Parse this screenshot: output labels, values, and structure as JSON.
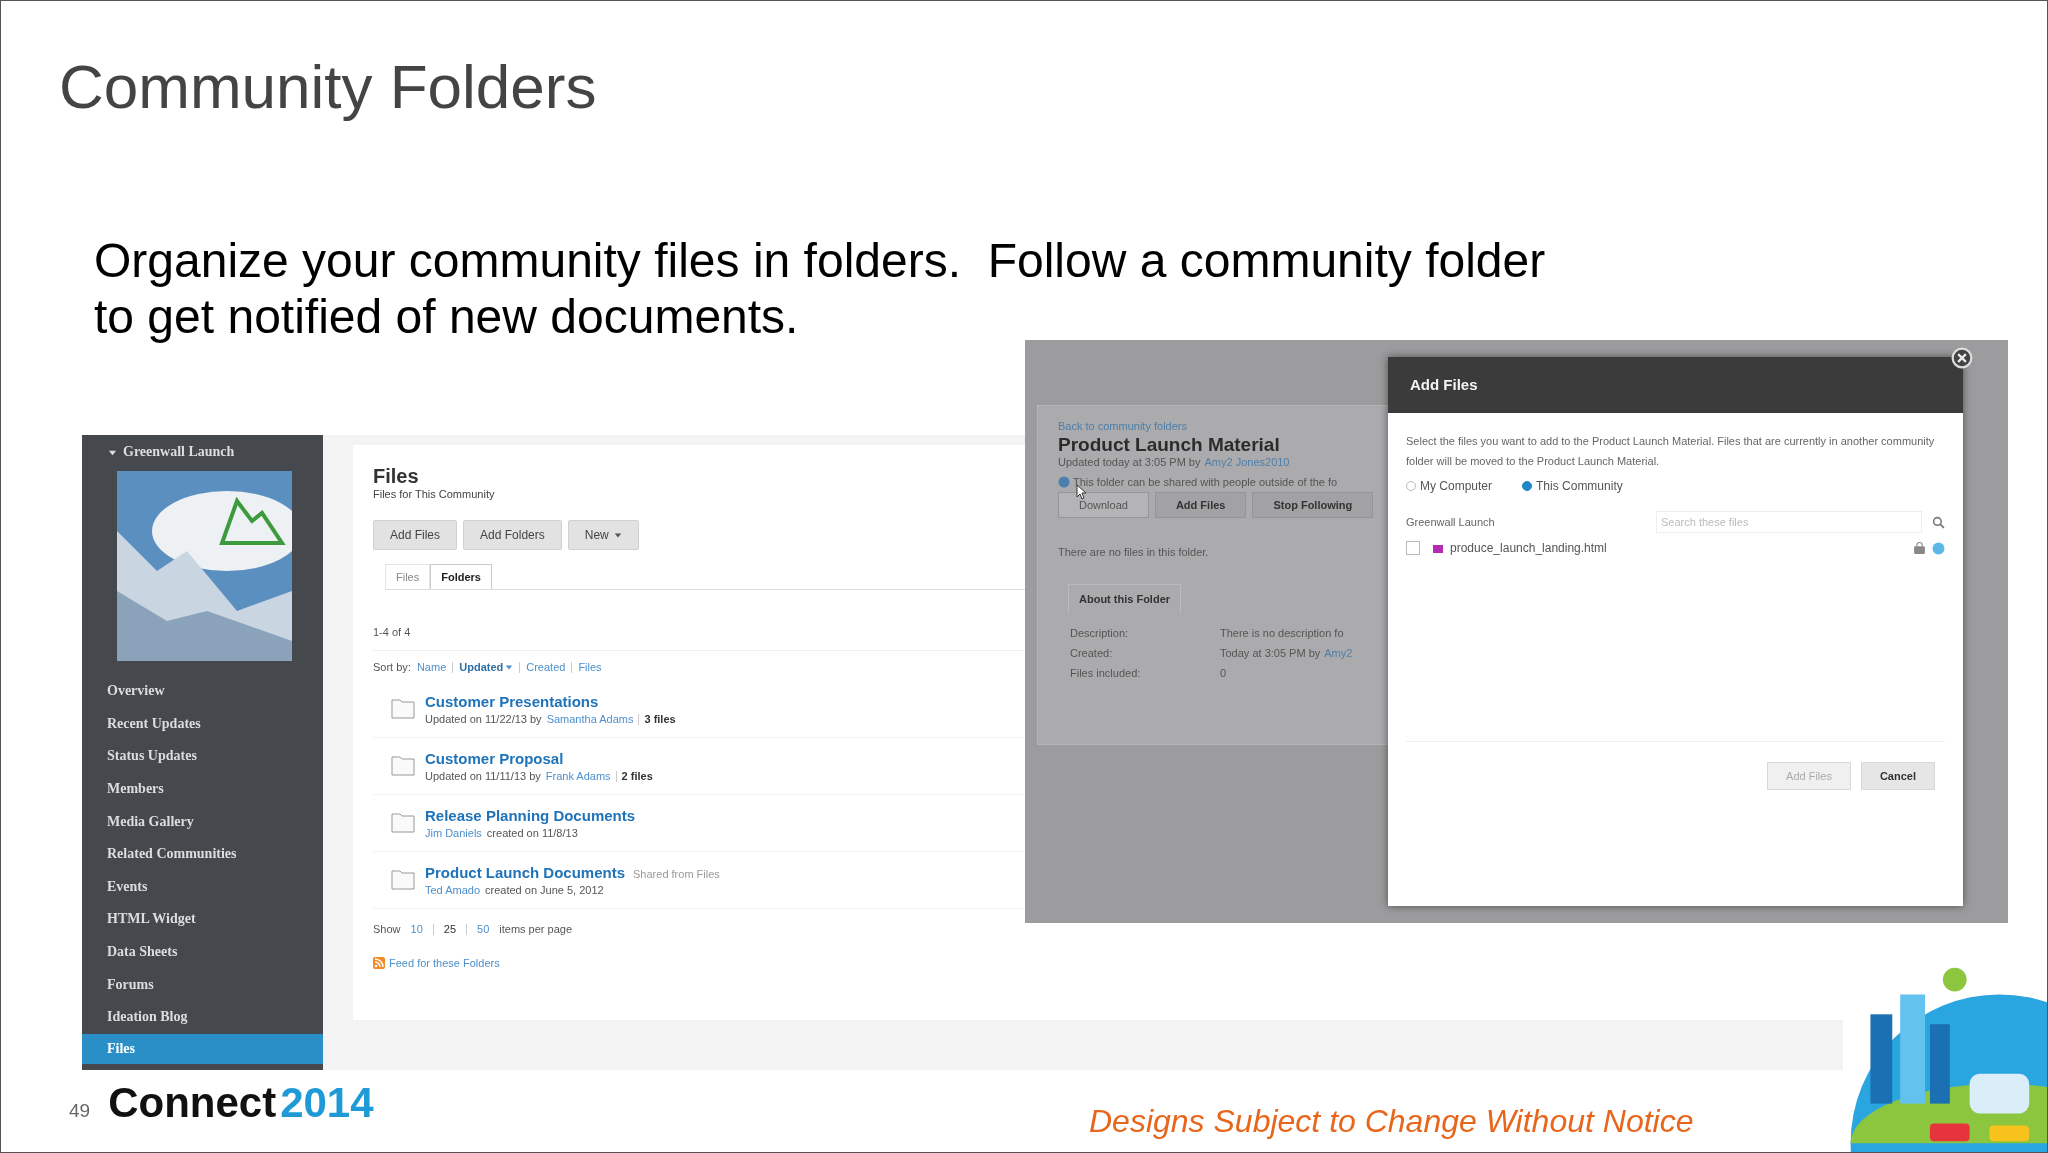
{
  "slide": {
    "title": "Community Folders",
    "subtitle_lines": [
      "Organize your community files in folders.  Follow a community folder",
      "to get notified of new documents."
    ],
    "page_number": "49",
    "brand": {
      "word": "Connect",
      "year": "2014"
    },
    "disclaimer": "Designs Subject to Change Without Notice"
  },
  "community_page": {
    "sidebar": {
      "community": "Greenwall Launch",
      "expanded": true,
      "items": [
        {
          "label": "Overview",
          "selected": false
        },
        {
          "label": "Recent Updates",
          "selected": false
        },
        {
          "label": "Status Updates",
          "selected": false
        },
        {
          "label": "Members",
          "selected": false
        },
        {
          "label": "Media Gallery",
          "selected": false
        },
        {
          "label": "Related Communities",
          "selected": false
        },
        {
          "label": "Events",
          "selected": false
        },
        {
          "label": "HTML Widget",
          "selected": false
        },
        {
          "label": "Data Sheets",
          "selected": false
        },
        {
          "label": "Forums",
          "selected": false
        },
        {
          "label": "Ideation Blog",
          "selected": false
        },
        {
          "label": "Files",
          "selected": true
        }
      ]
    },
    "files": {
      "title": "Files",
      "subtitle": "Files for This Community",
      "buttons": [
        {
          "label": "Add Files",
          "kind": "plain"
        },
        {
          "label": "Add Folders",
          "kind": "plain"
        },
        {
          "label": "New",
          "kind": "menu"
        }
      ],
      "tabs": [
        {
          "label": "Files",
          "selected": false
        },
        {
          "label": "Folders",
          "selected": true
        }
      ],
      "count": "1-4 of 4",
      "sort_label": "Sort by:",
      "sort_options": [
        {
          "label": "Name",
          "selected": false
        },
        {
          "label": "Updated",
          "selected": true
        },
        {
          "label": "Created",
          "selected": false
        },
        {
          "label": "Files",
          "selected": false
        }
      ],
      "folders": [
        {
          "title": "Customer Presentations",
          "meta": [
            {
              "kind": "text",
              "text": "Updated on 11/22/13 by"
            },
            {
              "kind": "link",
              "text": "Samantha Adams"
            },
            {
              "kind": "divider"
            },
            {
              "kind": "bold",
              "text": "3 files"
            }
          ]
        },
        {
          "title": "Customer Proposal",
          "meta": [
            {
              "kind": "text",
              "text": "Updated on 11/11/13 by"
            },
            {
              "kind": "link",
              "text": "Frank Adams"
            },
            {
              "kind": "divider"
            },
            {
              "kind": "bold",
              "text": "2 files"
            }
          ]
        },
        {
          "title": "Release Planning Documents",
          "meta": [
            {
              "kind": "link",
              "text": "Jim Daniels"
            },
            {
              "kind": "text",
              "text": "created on 11/8/13"
            }
          ]
        },
        {
          "title": "Product Launch Documents",
          "note": "Shared from Files",
          "meta": [
            {
              "kind": "link",
              "text": "Ted Amado"
            },
            {
              "kind": "text",
              "text": "created on June 5, 2012"
            }
          ]
        }
      ],
      "show_label": "Show",
      "page_sizes": [
        {
          "label": "10",
          "selected": false
        },
        {
          "label": "25",
          "selected": true
        },
        {
          "label": "50",
          "selected": false
        }
      ],
      "per_page_label": "items per page",
      "feed_link": "Feed for these Folders"
    }
  },
  "add_files_screen": {
    "folder_page": {
      "back_link": "Back to community folders",
      "title": "Product Launch Material",
      "updated": "Updated today at 3:05 PM by",
      "updated_by": "Amy2 Jones2010",
      "share_note": "This folder can be shared with people outside of the fo",
      "buttons": [
        {
          "label": "Download",
          "disabled": true
        },
        {
          "label": "Add Files",
          "disabled": false
        },
        {
          "label": "Stop Following",
          "disabled": false
        }
      ],
      "empty_message": "There are no files in this folder.",
      "tab": "About this Folder",
      "details": [
        {
          "label": "Description:",
          "value": "There is no description fo"
        },
        {
          "label": "Created:",
          "value": "Today at 3:05 PM by",
          "link": "Amy2"
        },
        {
          "label": "Files included:",
          "value": "0"
        }
      ]
    },
    "dialog": {
      "title": "Add Files",
      "description": "Select the files you want to add to the Product Launch Material. Files that are currently in another community folder will be moved to the Product Launch Material.",
      "sources": [
        {
          "label": "My Computer",
          "selected": false
        },
        {
          "label": "This Community",
          "selected": true
        }
      ],
      "community": "Greenwall Launch",
      "search_placeholder": "Search these files",
      "files": [
        {
          "name": "produce_launch_landing.html",
          "checked": false
        }
      ],
      "buttons": [
        {
          "label": "Add Files",
          "disabled": true
        },
        {
          "label": "Cancel",
          "disabled": false
        }
      ]
    }
  }
}
